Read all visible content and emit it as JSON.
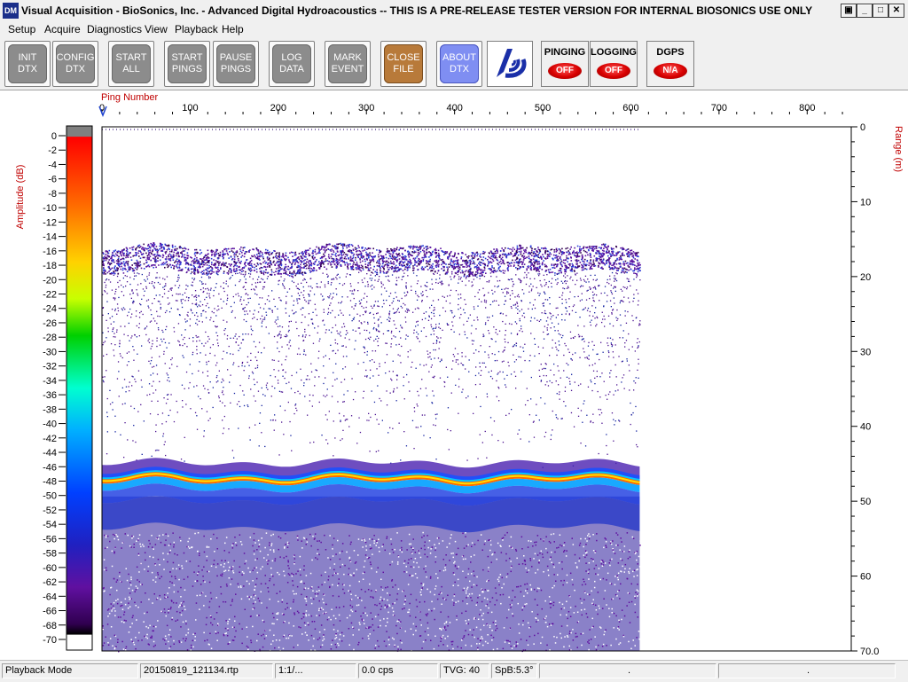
{
  "window": {
    "icon_text": "DM",
    "title": "Visual Acquisition  -  BioSonics, Inc.  -  Advanced Digital Hydroacoustics  -- THIS IS A PRE-RELEASE TESTER VERSION FOR INTERNAL BIOSONICS USE ONLY",
    "controls": [
      "restore",
      "minimize",
      "maximize",
      "close"
    ]
  },
  "menu": [
    "Setup",
    "Acquire",
    "Diagnostics",
    "View",
    "Playback",
    "Help"
  ],
  "toolbar": {
    "buttons": [
      {
        "label": "INIT\nDTX",
        "style": "gray"
      },
      {
        "label": "CONFIG\nDTX",
        "style": "gray"
      },
      {
        "label": "START\nALL",
        "style": "gray"
      },
      {
        "label": "START\nPINGS",
        "style": "gray"
      },
      {
        "label": "PAUSE\nPINGS",
        "style": "gray"
      },
      {
        "label": "LOG\nDATA",
        "style": "gray"
      },
      {
        "label": "MARK\nEVENT",
        "style": "gray"
      },
      {
        "label": "CLOSE\nFILE",
        "style": "brown"
      },
      {
        "label": "ABOUT\nDTX",
        "style": "blue"
      }
    ],
    "logo_icon": "biosonics-logo-icon",
    "indicators": [
      {
        "label": "PINGING",
        "state": "OFF"
      },
      {
        "label": "LOGGING",
        "state": "OFF"
      },
      {
        "label": "DGPS",
        "state": "N/A"
      }
    ]
  },
  "echogram": {
    "x_axis_title": "Ping Number",
    "x_ticks": [
      "0",
      "100",
      "200",
      "300",
      "400",
      "500",
      "600",
      "700",
      "800"
    ],
    "y_axis_title": "Range (m)",
    "y_ticks": [
      "0",
      "10",
      "20",
      "30",
      "40",
      "50",
      "60",
      "70.0"
    ],
    "colorbar_title": "Amplitude (dB)",
    "colorbar_ticks": [
      "0",
      "-2",
      "-4",
      "-6",
      "-8",
      "-10",
      "-12",
      "-14",
      "-16",
      "-18",
      "-20",
      "-22",
      "-24",
      "-26",
      "-28",
      "-30",
      "-32",
      "-34",
      "-36",
      "-38",
      "-40",
      "-42",
      "-44",
      "-46",
      "-48",
      "-50",
      "-52",
      "-54",
      "-56",
      "-58",
      "-60",
      "-62",
      "-64",
      "-66",
      "-68",
      "-70"
    ],
    "colors": {
      "axis_title": "#c00000",
      "colormap": [
        "#808080",
        "#ff0000",
        "#ff6a00",
        "#ffd200",
        "#c8ff00",
        "#00d000",
        "#00ffd0",
        "#00b0ff",
        "#0040ff",
        "#2020c0",
        "#6010a0",
        "#300050",
        "#000000"
      ]
    },
    "pings_recorded": 610,
    "max_pings": 850,
    "max_range_m": 70,
    "surface_layer_depth_m": 17,
    "bottom_depth_m": 47
  },
  "statusbar": {
    "mode": "Playback Mode",
    "file": "20150819_121134.rtp",
    "ratio": "1:1/...",
    "rate": "0.0 cps",
    "tvg": "TVG: 40",
    "spb": "SpB:5.3°",
    "extra1": ".",
    "extra2": "."
  }
}
